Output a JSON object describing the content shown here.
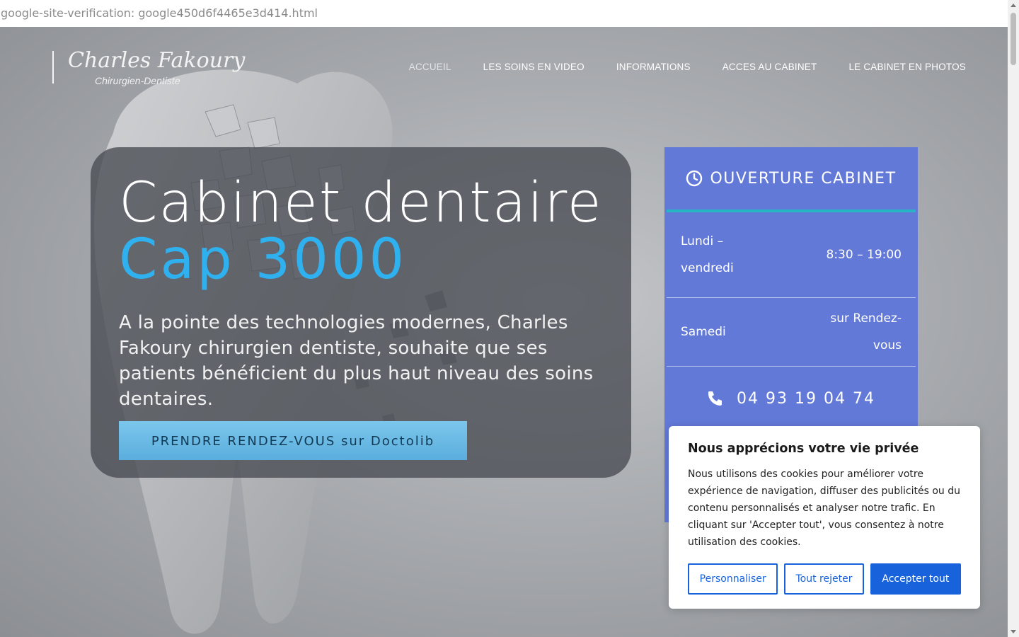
{
  "verification_text": "google-site-verification: google450d6f4465e3d414.html",
  "logo": {
    "signature": "Charles Fakoury",
    "subtitle": "Chirurgien-Dentiste"
  },
  "nav": [
    {
      "label": "ACCUEIL"
    },
    {
      "label": "LES SOINS EN VIDEO"
    },
    {
      "label": "INFORMATIONS"
    },
    {
      "label": "ACCES AU CABINET"
    },
    {
      "label": "LE CABINET EN PHOTOS"
    }
  ],
  "hero": {
    "title_line1": "Cabinet dentaire",
    "title_line2": "Cap 3000",
    "intro": "A la pointe des technologies modernes, Charles Fakoury chirurgien dentiste, souhaite que ses patients bénéficient du plus haut niveau des soins dentaires.",
    "cta_label": "PRENDRE RENDEZ-VOUS sur Doctolib"
  },
  "hours": {
    "title": "OUVERTURE CABINET",
    "rows": [
      {
        "day": "Lundi – vendredi",
        "time": "8:30 – 19:00"
      },
      {
        "day": "Samedi",
        "time": "sur Rendez-vous"
      }
    ],
    "phone": "04 93 19 04 74"
  },
  "cookie": {
    "title": "Nous apprécions votre vie privée",
    "text": "Nous utilisons des cookies pour améliorer votre expérience de navigation, diffuser des publicités ou du contenu personnalisés et analyser notre trafic. En cliquant sur 'Accepter tout', vous consentez à notre utilisation des cookies.",
    "customize_label": "Personnaliser",
    "reject_label": "Tout rejeter",
    "accept_label": "Accepter tout"
  },
  "colors": {
    "accent_blue": "#2fb0ef",
    "hours_panel": "#6379d8",
    "hours_divider": "#27b5c6",
    "cookie_primary": "#1863dc"
  }
}
